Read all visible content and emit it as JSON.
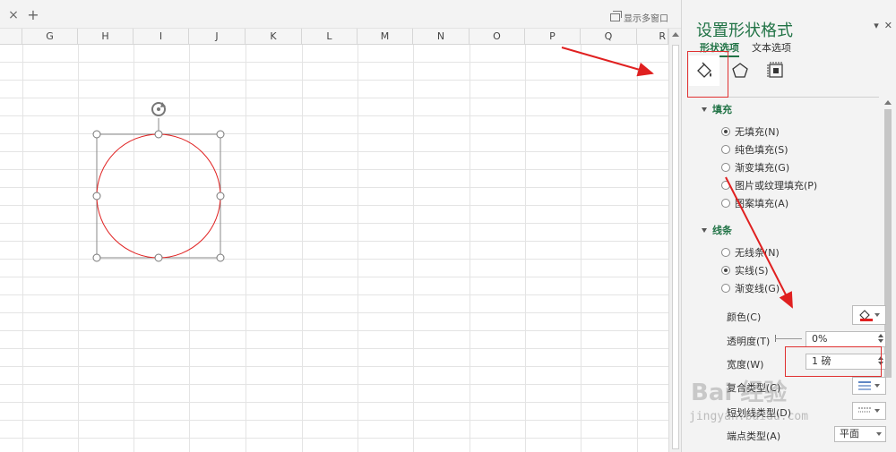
{
  "tabbar": {
    "close_icon": "×",
    "add_icon": "+",
    "multi_window_label": "显示多窗口"
  },
  "columns": [
    "G",
    "H",
    "I",
    "J",
    "K",
    "L",
    "M",
    "N",
    "O",
    "P",
    "Q",
    "R"
  ],
  "pane": {
    "title": "设置形状格式",
    "tabs": [
      "形状选项",
      "文本选项"
    ],
    "icons": [
      "fill-line-icon",
      "effects-pentagon-icon",
      "size-properties-icon"
    ],
    "fill_section": {
      "header": "填充",
      "options": [
        "无填充(N)",
        "纯色填充(S)",
        "渐变填充(G)",
        "图片或纹理填充(P)",
        "图案填充(A)"
      ],
      "selected": 0
    },
    "line_section": {
      "header": "线条",
      "options": [
        "无线条(N)",
        "实线(S)",
        "渐变线(G)"
      ],
      "selected": 1
    },
    "props": {
      "color_label": "颜色(C)",
      "transparency_label": "透明度(T)",
      "transparency_value": "0%",
      "width_label": "宽度(W)",
      "width_value": "1 磅",
      "compound_label": "复合类型(C)",
      "dash_label": "短划线类型(D)",
      "cap_label": "端点类型(A)",
      "cap_value": "平面"
    },
    "accent_color": "#217346",
    "line_color": "#e02020"
  },
  "watermark": {
    "brand": "Bai 经验",
    "url": "jingyan.baidu.com"
  }
}
